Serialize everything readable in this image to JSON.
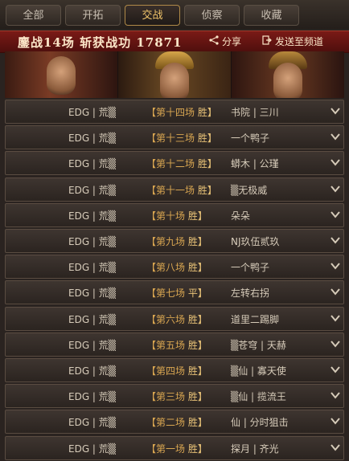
{
  "tabs": [
    {
      "label": "全部",
      "active": false
    },
    {
      "label": "开拓",
      "active": false
    },
    {
      "label": "交战",
      "active": true
    },
    {
      "label": "侦察",
      "active": false
    },
    {
      "label": "收藏",
      "active": false
    }
  ],
  "banner": {
    "title": "鏖战14场  斩获战功 17871",
    "share_label": "分享",
    "send_label": "发送至频道"
  },
  "battles": [
    {
      "left": "EDG | 荒▒",
      "round": "【第十四场",
      "result": "胜】",
      "right": "书院 | 三川"
    },
    {
      "left": "EDG | 荒▒",
      "round": "【第十三场",
      "result": "胜】",
      "right": "一个鸭子"
    },
    {
      "left": "EDG | 荒▒",
      "round": "【第十二场",
      "result": "胜】",
      "right": "蟒木 | 公瑾"
    },
    {
      "left": "EDG | 荒▒",
      "round": "【第十一场",
      "result": "胜】",
      "right": "▒无极威"
    },
    {
      "left": "EDG | 荒▒",
      "round": "【第十场",
      "result": "胜】",
      "right": "朵朵"
    },
    {
      "left": "EDG | 荒▒",
      "round": "【第九场",
      "result": "胜】",
      "right": "NJ玖伍贰玖"
    },
    {
      "left": "EDG | 荒▒",
      "round": "【第八场",
      "result": "胜】",
      "right": "一个鸭子"
    },
    {
      "left": "EDG | 荒▒",
      "round": "【第七场",
      "result": "平】",
      "right": "左转右拐"
    },
    {
      "left": "EDG | 荒▒",
      "round": "【第六场",
      "result": "胜】",
      "right": "道里二踢脚"
    },
    {
      "left": "EDG | 荒▒",
      "round": "【第五场",
      "result": "胜】",
      "right": "▒苍穹 | 天赫"
    },
    {
      "left": "EDG | 荒▒",
      "round": "【第四场",
      "result": "胜】",
      "right": "▒仙 | 寡天使"
    },
    {
      "left": "EDG | 荒▒",
      "round": "【第三场",
      "result": "胜】",
      "right": "▒仙 | 揽流王"
    },
    {
      "left": "EDG | 荒▒",
      "round": "【第二场",
      "result": "胜】",
      "right": "仙 | 分时狙击"
    },
    {
      "left": "EDG | 荒▒",
      "round": "【第一场",
      "result": "胜】",
      "right": "探月 | 齐光"
    }
  ],
  "colors": {
    "accent": "#f0c46a",
    "banner": "#6b1511",
    "row_bg": "#332b26"
  },
  "icons": {
    "share": "share-icon",
    "send": "send-icon",
    "expand": "chevron-down-icon"
  }
}
